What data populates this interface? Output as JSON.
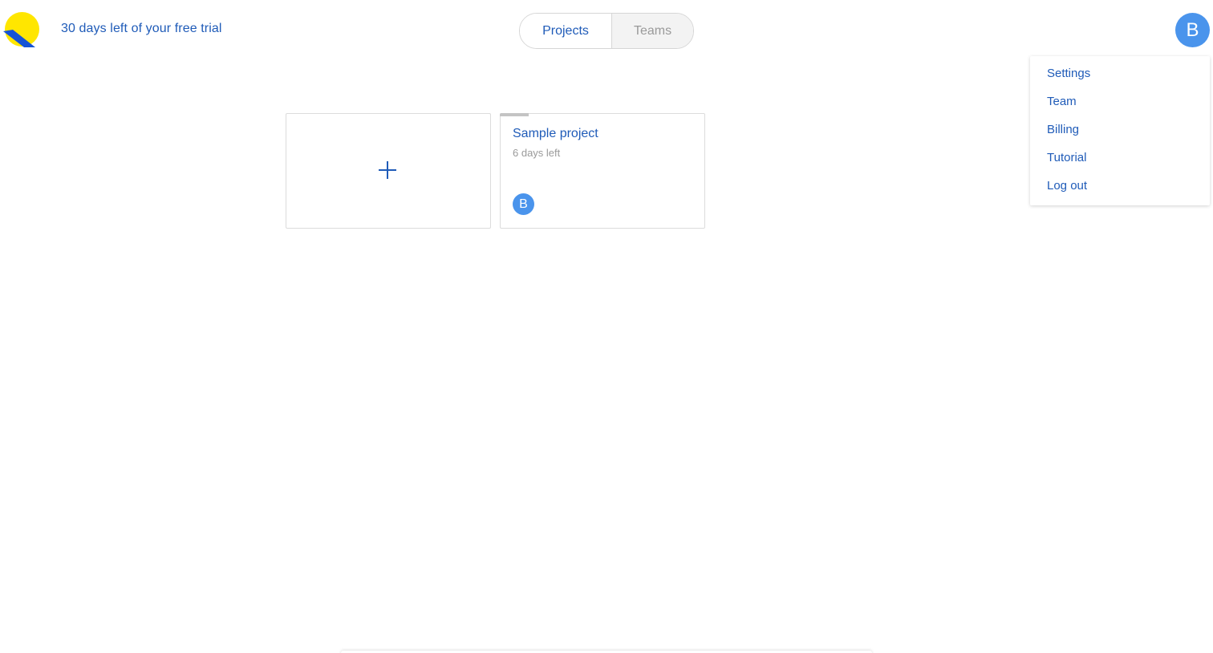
{
  "header": {
    "logo_icon": "app-logo-icon",
    "trial_text": "30 days left of your free trial"
  },
  "tabs": [
    {
      "label": "Projects",
      "active": true
    },
    {
      "label": "Teams",
      "active": false
    }
  ],
  "user": {
    "avatar_initial": "B",
    "avatar_color": "#4a94ec"
  },
  "user_menu": {
    "items": [
      {
        "label": "Settings"
      },
      {
        "label": "Team"
      },
      {
        "label": "Billing"
      },
      {
        "label": "Tutorial"
      },
      {
        "label": "Log out"
      }
    ]
  },
  "projects": {
    "add_icon": "plus-icon",
    "cards": [
      {
        "title": "Sample project",
        "subtitle": "6 days left",
        "member_initial": "B",
        "progress": 0.14
      }
    ]
  },
  "colors": {
    "accent": "#1f5bb8",
    "avatar": "#4a94ec",
    "logo_yellow": "#ffe600",
    "logo_blue": "#1553d6",
    "muted": "#9a9a9a"
  }
}
